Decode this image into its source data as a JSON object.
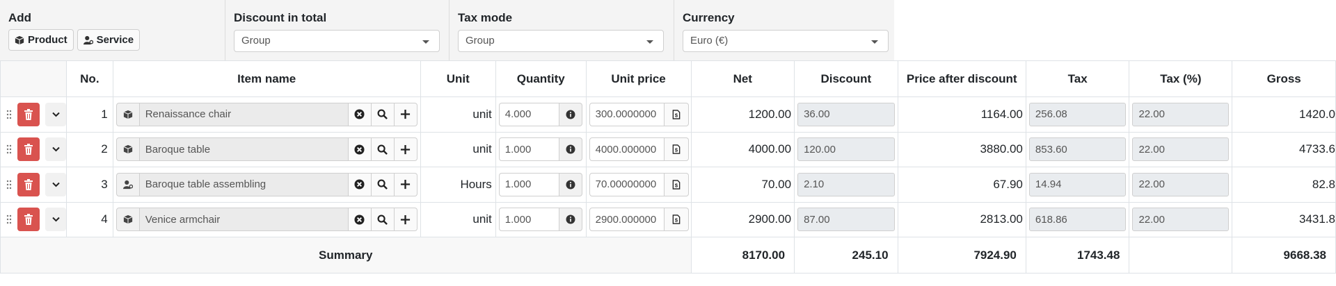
{
  "options": {
    "add": {
      "label": "Add",
      "product_btn": "Product",
      "service_btn": "Service"
    },
    "discount": {
      "label": "Discount in total",
      "value": "Group"
    },
    "tax_mode": {
      "label": "Tax mode",
      "value": "Group"
    },
    "currency": {
      "label": "Currency",
      "value": "Euro (€)"
    }
  },
  "table": {
    "headers": {
      "no": "No.",
      "item_name": "Item name",
      "unit": "Unit",
      "quantity": "Quantity",
      "unit_price": "Unit price",
      "net": "Net",
      "discount": "Discount",
      "price_after_discount": "Price after discount",
      "tax": "Tax",
      "tax_pct": "Tax (%)",
      "gross": "Gross"
    },
    "rows": [
      {
        "no": "1",
        "type_icon": "product-icon",
        "item_name": "Renaissance chair",
        "unit": "unit",
        "quantity": "4.000",
        "unit_price": "300.0000000",
        "net": "1200.00",
        "discount": "36.00",
        "price_after_discount": "1164.00",
        "tax": "256.08",
        "tax_pct": "22.00",
        "gross": "1420.0"
      },
      {
        "no": "2",
        "type_icon": "product-icon",
        "item_name": "Baroque table",
        "unit": "unit",
        "quantity": "1.000",
        "unit_price": "4000.000000",
        "net": "4000.00",
        "discount": "120.00",
        "price_after_discount": "3880.00",
        "tax": "853.60",
        "tax_pct": "22.00",
        "gross": "4733.6"
      },
      {
        "no": "3",
        "type_icon": "service-icon",
        "item_name": "Baroque table assembling",
        "unit": "Hours",
        "quantity": "1.000",
        "unit_price": "70.00000000",
        "net": "70.00",
        "discount": "2.10",
        "price_after_discount": "67.90",
        "tax": "14.94",
        "tax_pct": "22.00",
        "gross": "82.8"
      },
      {
        "no": "4",
        "type_icon": "product-icon",
        "item_name": "Venice armchair",
        "unit": "unit",
        "quantity": "1.000",
        "unit_price": "2900.000000",
        "net": "2900.00",
        "discount": "87.00",
        "price_after_discount": "2813.00",
        "tax": "618.86",
        "tax_pct": "22.00",
        "gross": "3431.8"
      }
    ],
    "summary": {
      "label": "Summary",
      "net": "8170.00",
      "discount": "245.10",
      "price_after_discount": "7924.90",
      "tax": "1743.48",
      "gross": "9668.38"
    }
  },
  "colors": {
    "delete": "#d9534f",
    "panel": "#f4f4f4",
    "readonly": "#e9ecef"
  }
}
